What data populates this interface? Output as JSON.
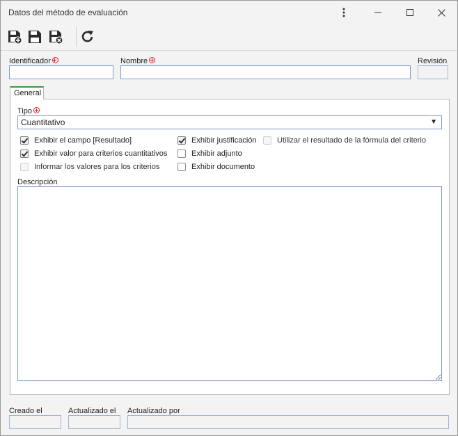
{
  "window": {
    "title": "Datos del método de evaluación"
  },
  "toolbar": {
    "tools": [
      "save-new-icon",
      "save-icon",
      "save-close-icon",
      "refresh-icon"
    ]
  },
  "header": {
    "identificador_label": "Identificador",
    "identificador_value": "",
    "nombre_label": "Nombre",
    "nombre_value": "",
    "revision_label": "Revisión",
    "revision_value": ""
  },
  "tabs": [
    {
      "label": "General",
      "active": true
    }
  ],
  "general": {
    "tipo_label": "Tipo",
    "tipo_value": "Cuantitativo",
    "checkboxes": [
      {
        "label": "Exhibir el campo [Resultado]",
        "checked": true,
        "disabled": false
      },
      {
        "label": "Exhibir valor para criterios cuantitativos",
        "checked": true,
        "disabled": false
      },
      {
        "label": "Informar los valores para los criterios",
        "checked": false,
        "disabled": true
      },
      {
        "label": "Exhibir justificación",
        "checked": true,
        "disabled": false
      },
      {
        "label": "Exhibir adjunto",
        "checked": false,
        "disabled": false
      },
      {
        "label": "Exhibir documento",
        "checked": false,
        "disabled": false
      },
      {
        "label": "Utilizar el resultado de la fórmula del criterio",
        "checked": false,
        "disabled": true
      }
    ],
    "descripcion_label": "Descripción",
    "descripcion_value": ""
  },
  "footer": {
    "creado_label": "Creado el",
    "actualizado_label": "Actualizado el",
    "actualizado_por_label": "Actualizado por"
  },
  "colors": {
    "accent_tab": "#3a9a3a",
    "required": "#e02020",
    "input_border": "#7a9cc6"
  }
}
